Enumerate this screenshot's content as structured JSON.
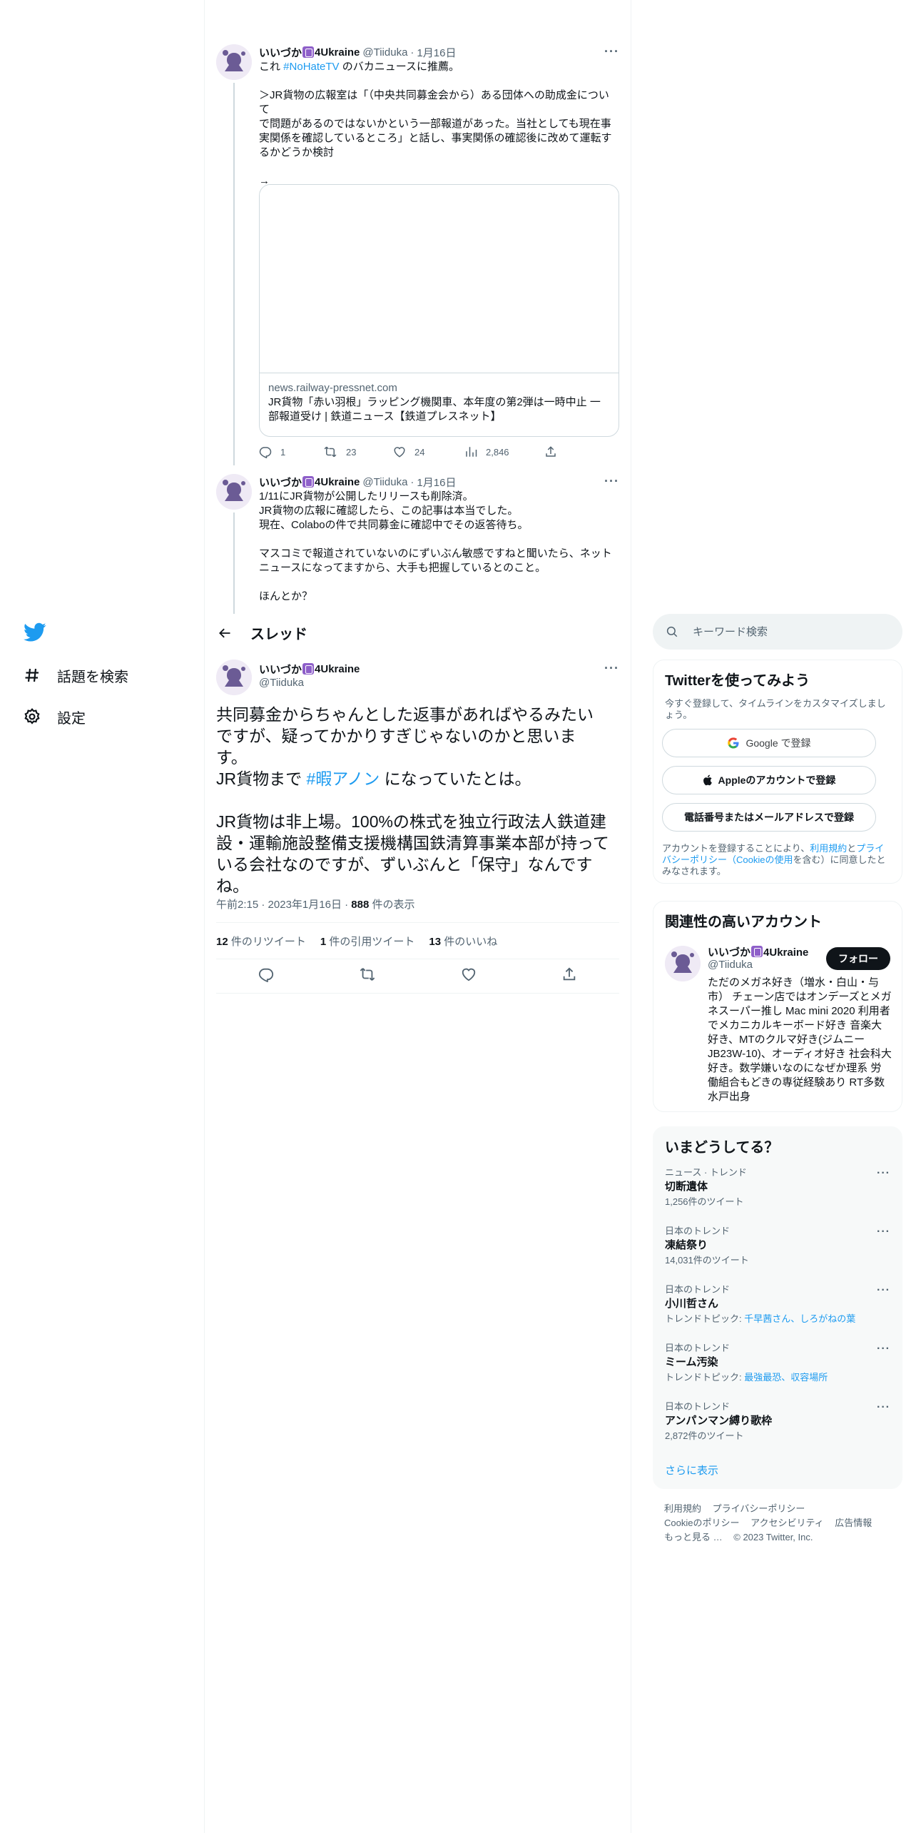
{
  "colors": {
    "accent": "#1d9bf0",
    "text": "#0f1419",
    "secondary": "#536471",
    "border": "#eff3f4"
  },
  "nav": {
    "logo": "twitter-bird-icon",
    "items": [
      {
        "icon": "hashtag-icon",
        "label": "話題を検索"
      },
      {
        "icon": "gear-icon",
        "label": "設定"
      }
    ]
  },
  "header": {
    "title": "スレッド"
  },
  "tweet1": {
    "name": "いいづか",
    "name_suffix": "4Ukraine",
    "handle": "@Tiiduka",
    "date": "1月16日",
    "text_pre": "これ ",
    "hashtag": "#NoHateTV",
    "text_post": " のバカニュースに推薦。",
    "quote": "＞JR貨物の広報室は「（中央共同募金会から）ある団体への助成金について\nで問題があるのではないかという一部報道があった。当社としても現在事\n実関係を確認しているところ」と話し、事実関係の確認後に改めて運転す\nるかどうか検討",
    "arrow": "→",
    "card": {
      "domain": "news.railway-pressnet.com",
      "title": "JR貨物「赤い羽根」ラッピング機関車、本年度の第2弾は一時中止 一部報道受け | 鉄道ニュース【鉄道プレスネット】"
    },
    "replies": "1",
    "retweets": "23",
    "likes": "24",
    "views": "2,846"
  },
  "tweet2": {
    "name": "いいづか",
    "name_suffix": "4Ukraine",
    "handle": "@Tiiduka",
    "date": "1月16日",
    "text": "1/11にJR貨物が公開したリリースも削除済。\nJR貨物の広報に確認したら、この記事は本当でした。\n現在、Colaboの件で共同募金に確認中でその返答待ち。\n\nマスコミで報道されていないのにずいぶん敏感ですねと聞いたら、ネット\nニュースになってますから、大手も把握しているとのこと。\n\nほんとか？"
  },
  "main_tweet": {
    "name": "いいづか",
    "name_suffix": "4Ukraine",
    "handle": "@Tiiduka",
    "text_pre": "共同募金からちゃんとした返事があればやるみたい\nですが、疑ってかかりすぎじゃないのかと思いま\nす。\nJR貨物まで ",
    "hashtag": "#暇アノン",
    "text_post": " になっていたとは。\n\nJR貨物は非上場。100%の株式を独立行政法人鉄道建\n設・運輸施設整備支援機構国鉄清算事業本部が持って\nいる会社なのですが、ずいぶんと「保守」なんです\nね。",
    "time": "午前2:15",
    "full_date": "2023年1月16日",
    "views": "888",
    "views_label": "件の表示",
    "retweets": "12",
    "retweets_label": "件のリツイート",
    "quotes": "1",
    "quotes_label": "件の引用ツイート",
    "likes": "13",
    "likes_label": "件のいいね"
  },
  "sidebar": {
    "search_placeholder": "キーワード検索",
    "signup": {
      "title": "Twitterを使ってみよう",
      "subtitle": "今すぐ登録して、タイムラインをカスタマイズしましょう。",
      "google": "Google で登録",
      "apple": "Appleのアカウントで登録",
      "phone": "電話番号またはメールアドレスで登録",
      "legal_pre": "アカウントを登録することにより、",
      "legal_terms": "利用規約",
      "legal_and": "と",
      "legal_privacy": "プライバシーポリシー（Cookieの使用",
      "legal_post": "を含む）に同意したとみなされます。"
    },
    "relevant": {
      "title": "関連性の高いアカウント",
      "name": "いいづか",
      "name_suffix": "4Ukraine",
      "handle": "@Tiiduka",
      "follow": "フォロー",
      "bio": "ただのメガネ好き（増水・白山・与市） チェーン店ではオンデーズとメガネスーパー推し Mac mini 2020 利用者でメカニカルキーボード好き 音楽大好き、MTのクルマ好き(ジムニーJB23W-10)、オーディオ好き 社会科大好き。数学嫌いなのになぜか理系 労働組合もどきの専従経験あり RT多数 水戸出身"
    },
    "trends": {
      "title": "いまどうしてる？",
      "items": [
        {
          "context": "ニュース · トレンド",
          "name": "切断遺体",
          "count": "1,256件のツイート"
        },
        {
          "context": "日本のトレンド",
          "name": "凍結祭り",
          "count": "14,031件のツイート"
        },
        {
          "context": "日本のトレンド",
          "name": "小川哲さん",
          "count_pre": "トレンドトピック: ",
          "count_link": "千早茜さん、しろがねの葉"
        },
        {
          "context": "日本のトレンド",
          "name": "ミーム汚染",
          "count_pre": "トレンドトピック: ",
          "count_link": "最強最恐、収容場所"
        },
        {
          "context": "日本のトレンド",
          "name": "アンパンマン縛り歌枠",
          "count": "2,872件のツイート"
        }
      ],
      "show_more": "さらに表示"
    },
    "footer": {
      "links": [
        "利用規約",
        "プライバシーポリシー",
        "Cookieのポリシー",
        "アクセシビリティ",
        "広告情報",
        "もっと見る …"
      ],
      "copyright": "© 2023 Twitter, Inc."
    }
  }
}
